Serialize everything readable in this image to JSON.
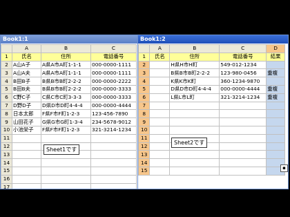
{
  "window1": {
    "title": "Book1:1",
    "col_headers": [
      "",
      "A",
      "B",
      "C"
    ],
    "header_row": {
      "num": "1",
      "cells": [
        "氏名",
        "住所",
        "電話番号"
      ]
    },
    "rows": [
      {
        "num": "2",
        "cells": [
          "A山A子",
          "A県A市A町1-1-1",
          "000-0000-1111"
        ]
      },
      {
        "num": "3",
        "cells": [
          "A山A夫",
          "A県A市A町1-1-1",
          "000-0000-1111"
        ]
      },
      {
        "num": "4",
        "cells": [
          "B田B子",
          "B県B市B町2-2-2",
          "000-0000-2222"
        ]
      },
      {
        "num": "5",
        "cells": [
          "B田B夫",
          "B県B市B町2-2-2",
          "000-0000-3333"
        ]
      },
      {
        "num": "6",
        "cells": [
          "C野C子",
          "C県C市C町3-3-3",
          "000-0000-3333"
        ]
      },
      {
        "num": "7",
        "cells": [
          "D野D子",
          "D県D市D町4-4-4",
          "000-0000-4444"
        ]
      },
      {
        "num": "8",
        "cells": [
          "日本太郎",
          "F県F市F町1-2-3",
          "123-456-7890"
        ]
      },
      {
        "num": "9",
        "cells": [
          "山田花子",
          "G県G市G町1-3-4",
          "234-5678-9012"
        ]
      },
      {
        "num": "10",
        "cells": [
          "小池栄子",
          "F県F市F町1-2-3",
          "321-3214-1234"
        ]
      },
      {
        "num": "11",
        "cells": [
          "",
          "",
          ""
        ]
      },
      {
        "num": "12",
        "cells": [
          "",
          "",
          ""
        ]
      },
      {
        "num": "13",
        "cells": [
          "",
          "",
          ""
        ]
      },
      {
        "num": "14",
        "cells": [
          "",
          "",
          ""
        ]
      },
      {
        "num": "15",
        "cells": [
          "",
          "",
          ""
        ]
      },
      {
        "num": "16",
        "cells": [
          "",
          "",
          ""
        ]
      },
      {
        "num": "17",
        "cells": [
          "",
          "",
          ""
        ]
      }
    ],
    "callout": "Sheet1です"
  },
  "window2": {
    "title": "Book1:2",
    "col_headers": [
      "",
      "A",
      "B",
      "C",
      "D"
    ],
    "header_row": {
      "num": "1",
      "cells": [
        "氏名",
        "住所",
        "電話番号",
        "結果"
      ]
    },
    "rows": [
      {
        "num": "2",
        "cells": [
          "",
          "H県H市H町",
          "549-012-1234",
          ""
        ]
      },
      {
        "num": "3",
        "cells": [
          "",
          "B県B市B町2-2-2",
          "123-980-0456",
          "重複"
        ]
      },
      {
        "num": "4",
        "cells": [
          "",
          "K県K市K町",
          "360-1234-9870",
          ""
        ]
      },
      {
        "num": "5",
        "cells": [
          "",
          "D県D市D町4-4-4",
          "000-0000-4444",
          "重複"
        ]
      },
      {
        "num": "6",
        "cells": [
          "",
          "L県L市L町",
          "321-3214-1234",
          "重複"
        ]
      },
      {
        "num": "7",
        "cells": [
          "",
          "",
          "",
          ""
        ]
      },
      {
        "num": "8",
        "cells": [
          "",
          "",
          "",
          ""
        ]
      },
      {
        "num": "9",
        "cells": [
          "",
          "",
          "",
          ""
        ]
      },
      {
        "num": "10",
        "cells": [
          "",
          "",
          "",
          ""
        ]
      },
      {
        "num": "11",
        "cells": [
          "",
          "",
          "",
          ""
        ]
      },
      {
        "num": "12",
        "cells": [
          "",
          "",
          "",
          ""
        ]
      },
      {
        "num": "13",
        "cells": [
          "",
          "",
          "",
          ""
        ]
      },
      {
        "num": "14",
        "cells": [
          "",
          "",
          "",
          ""
        ]
      },
      {
        "num": "15",
        "cells": [
          "",
          "",
          "",
          ""
        ]
      }
    ],
    "callout": "Sheet2です"
  }
}
